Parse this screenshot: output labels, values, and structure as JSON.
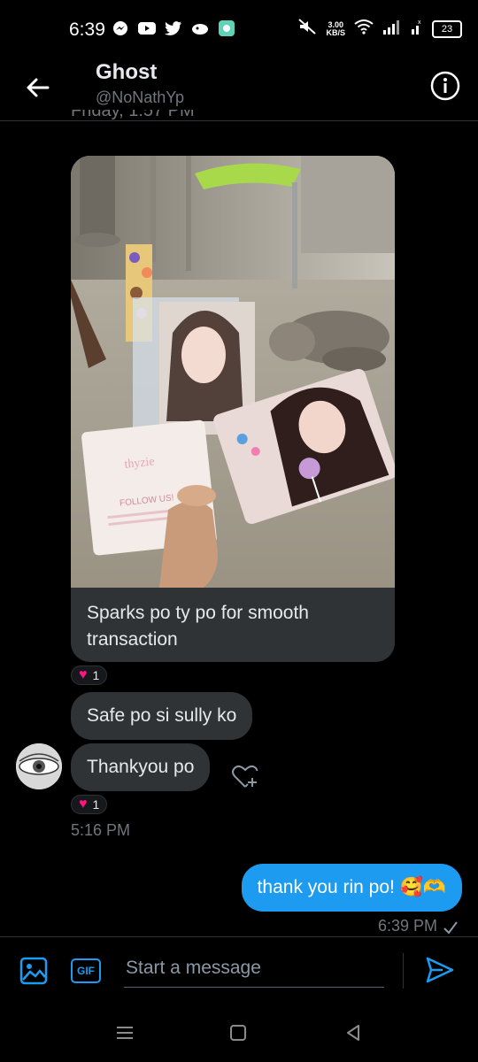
{
  "status_bar": {
    "time": "6:39",
    "speed_value": "3.00",
    "speed_unit": "KB/S",
    "battery": "23",
    "notification_icons": [
      "messenger-icon",
      "youtube-icon",
      "twitter-icon",
      "bird-icon",
      "app-icon"
    ]
  },
  "header": {
    "name": "Ghost",
    "handle": "@NoNathYp"
  },
  "conversation": {
    "clipped_date": "Friday, 1:57 PM",
    "image_caption": "Sparks po ty po for smooth transaction",
    "image_reaction_count": "1",
    "messages": [
      {
        "text": "Safe po si sully ko"
      },
      {
        "text": "Thankyou po"
      }
    ],
    "second_reaction_count": "1",
    "received_time": "5:16 PM",
    "sent_message": "thank you rin po! 🥰🫶",
    "sent_time": "6:39 PM"
  },
  "composer": {
    "gif_label": "GIF",
    "placeholder": "Start a message"
  },
  "colors": {
    "accent": "#1d9bf0",
    "heart": "#f91880",
    "bubble": "#2f3336"
  }
}
